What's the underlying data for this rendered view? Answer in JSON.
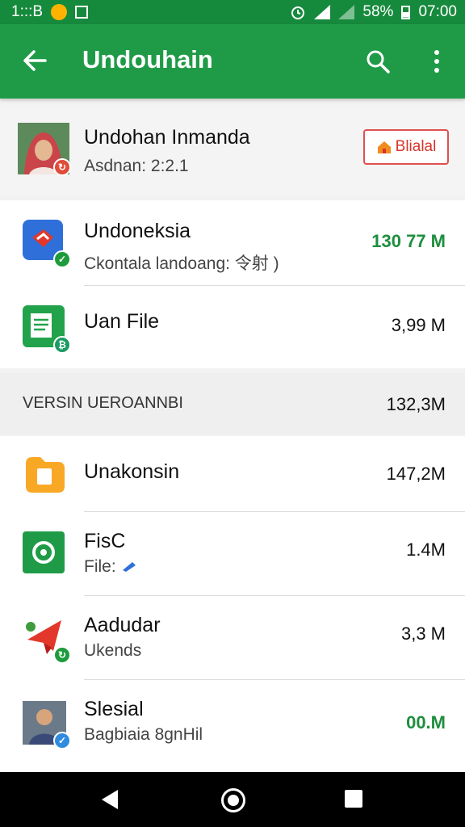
{
  "status_bar": {
    "time_left": "1:::B",
    "battery_pct": "58%",
    "clock": "07:00"
  },
  "app_bar": {
    "title": "Undouhain"
  },
  "header_card": {
    "name": "Undohan Inmanda",
    "subtitle": "Asdnan: 2:2.1",
    "button_label": "Blialal"
  },
  "items_top": [
    {
      "name": "Undoneksia",
      "subtitle": "Ckontala landoang: 令射 )",
      "size": "130 77 M",
      "size_green": true,
      "icon": "red-shield-app-icon"
    },
    {
      "name": "Uan File",
      "subtitle": "",
      "size": "3,99 M",
      "size_green": false,
      "icon": "green-doc-app-icon"
    }
  ],
  "section": {
    "label": "VERSIN UEROANNBI",
    "total": "132,3M"
  },
  "items_bottom": [
    {
      "name": "Unakonsin",
      "subtitle": "",
      "size": "147,2M",
      "icon": "orange-folder-app-icon"
    },
    {
      "name": "FisC",
      "subtitle": "File:",
      "size": "1.4M",
      "icon": "green-gear-app-icon"
    },
    {
      "name": "Aadudar",
      "subtitle": "Ukends",
      "size": "3,3 M",
      "icon": "red-bird-app-icon"
    },
    {
      "name": "Slesial",
      "subtitle": "Bagbiaia 8gnHil",
      "size": "00.M",
      "size_green": true,
      "icon": "avatar-man-app-icon"
    }
  ]
}
